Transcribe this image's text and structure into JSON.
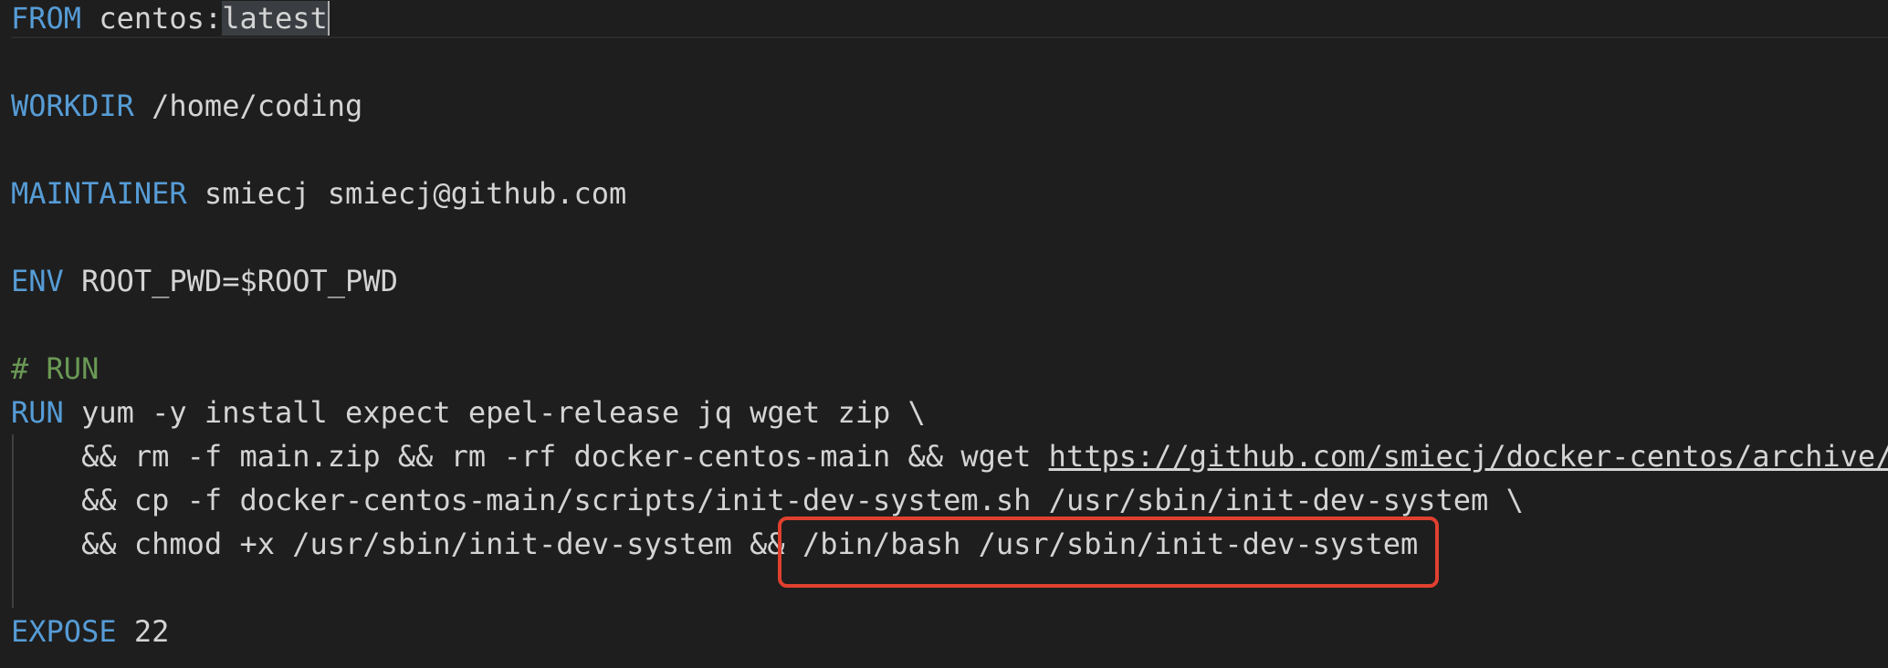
{
  "lines": {
    "l1": {
      "kw": "FROM",
      "rest_a": " centos:",
      "selected": "latest"
    },
    "l2": {
      "kw": "WORKDIR",
      "rest": " /home/coding"
    },
    "l3": {
      "kw": "MAINTAINER",
      "rest": " smiecj smiecj@github.com"
    },
    "l4": {
      "kw": "ENV",
      "rest": " ROOT_PWD=$ROOT_PWD"
    },
    "l5": {
      "comment": "# RUN"
    },
    "l6": {
      "kw": "RUN",
      "rest": " yum -y install expect epel-release jq wget zip \\"
    },
    "l7": {
      "rest": "    && rm -f main.zip && rm -rf docker-centos-main && wget ",
      "link": "https://github.com/smiecj/docker-centos/archive/"
    },
    "l8": {
      "rest": "    && cp -f docker-centos-main/scripts/init-dev-system.sh /usr/sbin/init-dev-system \\"
    },
    "l9": {
      "rest": "    && chmod +x /usr/sbin/init-dev-system && /bin/bash /usr/sbin/init-dev-system"
    },
    "l10": {
      "kw": "EXPOSE",
      "rest": " 22"
    }
  },
  "colors": {
    "keyword": "#569cd6",
    "comment": "#6a9955",
    "text": "#d4d4d4",
    "background": "#1e1e1e",
    "highlight_box": "#e0402f"
  }
}
